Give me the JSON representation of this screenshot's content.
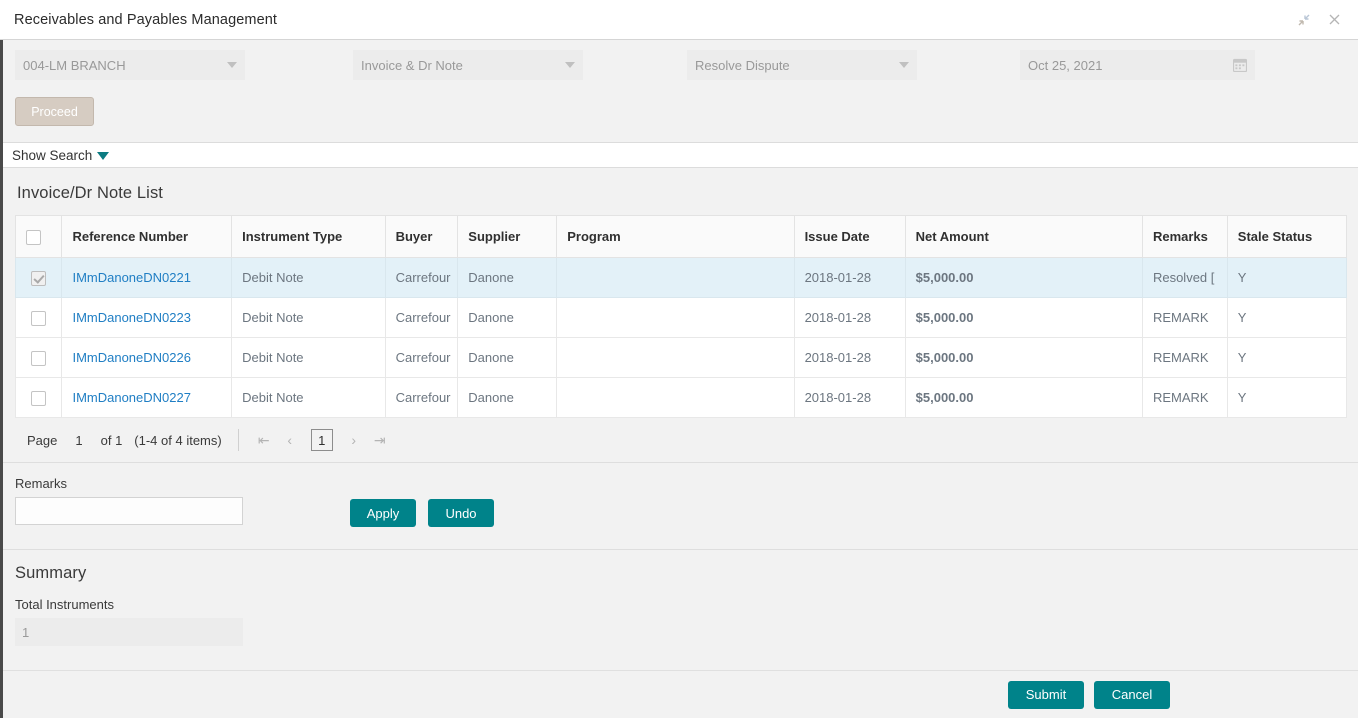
{
  "window": {
    "title": "Receivables and Payables Management",
    "minimize_icon": "collapse-arrows-icon",
    "close_icon": "close-icon"
  },
  "filters": {
    "branch": {
      "value": "004-LM BRANCH",
      "icon": "chevron-down-icon"
    },
    "instrument_type": {
      "value": "Invoice & Dr Note",
      "icon": "chevron-down-icon"
    },
    "action": {
      "value": "Resolve Dispute",
      "icon": "chevron-down-icon"
    },
    "date": {
      "value": "Oct 25, 2021",
      "icon": "calendar-icon"
    },
    "proceed_label": "Proceed"
  },
  "search": {
    "show_search_label": "Show Search",
    "toggle_icon": "triangle-down-icon"
  },
  "list": {
    "title": "Invoice/Dr Note List",
    "columns": [
      "Reference Number",
      "Instrument Type",
      "Buyer",
      "Supplier",
      "Program",
      "Issue Date",
      "Net Amount",
      "Remarks",
      "Stale Status"
    ],
    "rows": [
      {
        "selected": true,
        "reference_number": "IMmDanoneDN0221",
        "instrument_type": "Debit Note",
        "buyer": "Carrefour",
        "supplier": "Danone",
        "program": "",
        "issue_date": "2018-01-28",
        "net_amount": "$5,000.00",
        "remarks": "Resolved [",
        "stale_status": "Y"
      },
      {
        "selected": false,
        "reference_number": "IMmDanoneDN0223",
        "instrument_type": "Debit Note",
        "buyer": "Carrefour",
        "supplier": "Danone",
        "program": "",
        "issue_date": "2018-01-28",
        "net_amount": "$5,000.00",
        "remarks": "REMARK",
        "stale_status": "Y"
      },
      {
        "selected": false,
        "reference_number": "IMmDanoneDN0226",
        "instrument_type": "Debit Note",
        "buyer": "Carrefour",
        "supplier": "Danone",
        "program": "",
        "issue_date": "2018-01-28",
        "net_amount": "$5,000.00",
        "remarks": "REMARK",
        "stale_status": "Y"
      },
      {
        "selected": false,
        "reference_number": "IMmDanoneDN0227",
        "instrument_type": "Debit Note",
        "buyer": "Carrefour",
        "supplier": "Danone",
        "program": "",
        "issue_date": "2018-01-28",
        "net_amount": "$5,000.00",
        "remarks": "REMARK",
        "stale_status": "Y"
      }
    ]
  },
  "pagination": {
    "page_label": "Page",
    "page_number": "1",
    "of_label": "of 1",
    "items_label": "(1-4 of 4 items)",
    "first_icon": "first-page-icon",
    "prev_icon": "prev-page-icon",
    "current_page": "1",
    "next_icon": "next-page-icon",
    "last_icon": "last-page-icon"
  },
  "remarks_section": {
    "label": "Remarks",
    "value": "",
    "placeholder": "",
    "apply_label": "Apply",
    "undo_label": "Undo"
  },
  "summary": {
    "title": "Summary",
    "total_instruments_label": "Total Instruments",
    "total_instruments_value": "1"
  },
  "footer": {
    "submit_label": "Submit",
    "cancel_label": "Cancel"
  },
  "colors": {
    "accent_teal": "#00838a",
    "link_blue": "#1f7ec4",
    "selected_row": "#e3f1f8",
    "disabled_button": "#d6ccc2",
    "page_background": "#f2f2f2"
  }
}
